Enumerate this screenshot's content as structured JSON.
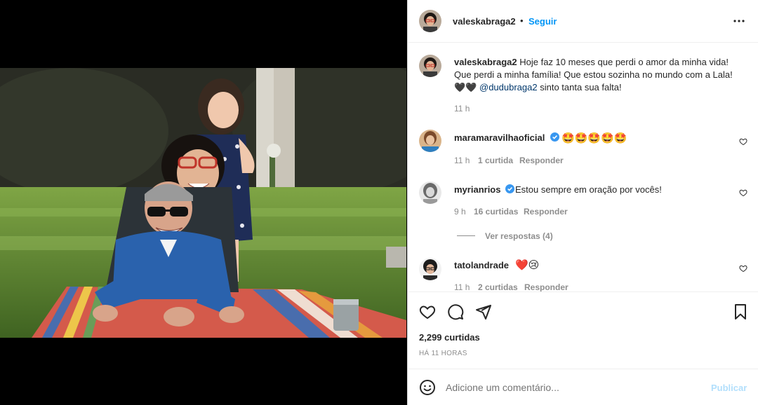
{
  "header": {
    "username": "valeskabraga2",
    "separator": "•",
    "follow_label": "Seguir",
    "more_icon": "more-horizontal-icon"
  },
  "caption": {
    "username": "valeskabraga2",
    "text_before_emoji": "Hoje faz 10 meses que perdi o amor da minha vida! Que perdi a minha família! Que estou sozinha no mundo com a Lala!",
    "emoji": "🖤🖤",
    "mention": "@dudubraga2",
    "text_after": "sinto tanta sua falta!",
    "time": "11 h"
  },
  "comments": [
    {
      "username": "maramaravilhaoficial",
      "verified": true,
      "text": "🤩🤩🤩🤩🤩",
      "time": "11 h",
      "likes": "1 curtida",
      "reply_label": "Responder"
    },
    {
      "username": "myrianrios",
      "verified": true,
      "text": "Estou sempre em oração por vocês!",
      "time": "9 h",
      "likes": "16 curtidas",
      "reply_label": "Responder",
      "view_replies": "Ver respostas (4)"
    },
    {
      "username": "tatolandrade",
      "verified": false,
      "text": "❤️😢",
      "time": "11 h",
      "likes": "2 curtidas",
      "reply_label": "Responder"
    }
  ],
  "actions": {
    "likes_count": "2,299 curtidas",
    "timestamp": "HÁ 11 HORAS"
  },
  "add_comment": {
    "placeholder": "Adicione um comentário...",
    "publish_label": "Publicar"
  },
  "colors": {
    "accent": "#0095f6",
    "verified": "#3897f0",
    "heart_red": "#ed4956"
  }
}
